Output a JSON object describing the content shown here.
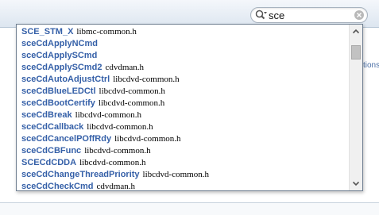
{
  "search": {
    "query": "sce",
    "search_icon": "search-icon",
    "clear_icon": "clear-icon"
  },
  "side_text": "tions",
  "results": [
    {
      "symbol": "SCE_STM_X",
      "header": "libmc-common.h"
    },
    {
      "symbol": "sceCdApplyNCmd",
      "header": ""
    },
    {
      "symbol": "sceCdApplySCmd",
      "header": ""
    },
    {
      "symbol": "sceCdApplySCmd2",
      "header": "cdvdman.h"
    },
    {
      "symbol": "sceCdAutoAdjustCtrl",
      "header": "libcdvd-common.h"
    },
    {
      "symbol": "sceCdBlueLEDCtl",
      "header": "libcdvd-common.h"
    },
    {
      "symbol": "sceCdBootCertify",
      "header": "libcdvd-common.h"
    },
    {
      "symbol": "sceCdBreak",
      "header": "libcdvd-common.h"
    },
    {
      "symbol": "sceCdCallback",
      "header": "libcdvd-common.h"
    },
    {
      "symbol": "sceCdCancelPOffRdy",
      "header": "libcdvd-common.h"
    },
    {
      "symbol": "sceCdCBFunc",
      "header": "libcdvd-common.h"
    },
    {
      "symbol": "SCECdCDDA",
      "header": "libcdvd-common.h"
    },
    {
      "symbol": "sceCdChangeThreadPriority",
      "header": "libcdvd-common.h"
    },
    {
      "symbol": "sceCdCheckCmd",
      "header": "cdvdman.h"
    }
  ],
  "scrollbar": {
    "up_icon": "scroll-up-arrow-icon",
    "down_icon": "scroll-down-arrow-icon"
  }
}
